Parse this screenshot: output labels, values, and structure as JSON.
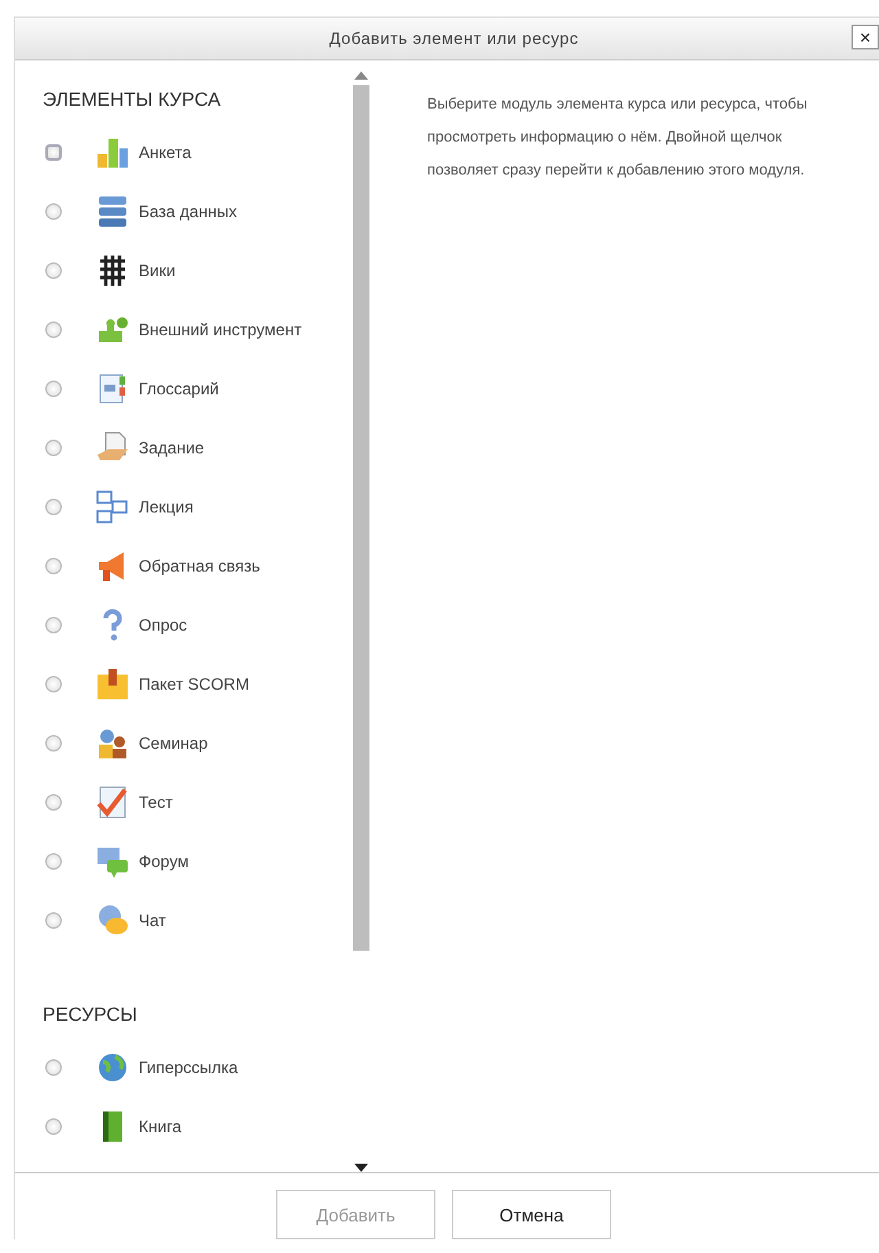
{
  "dialog": {
    "title": "Добавить элемент или ресурс",
    "close_label": "×"
  },
  "sections": [
    {
      "heading": "ЭЛЕМЕНТЫ КУРСА",
      "items": [
        {
          "label": "Анкета",
          "selected": false,
          "focused": true
        },
        {
          "label": "База данных",
          "selected": false,
          "focused": false
        },
        {
          "label": "Вики",
          "selected": false,
          "focused": false
        },
        {
          "label": "Внешний инструмент",
          "selected": false,
          "focused": false
        },
        {
          "label": "Глоссарий",
          "selected": false,
          "focused": false
        },
        {
          "label": "Задание",
          "selected": false,
          "focused": false
        },
        {
          "label": "Лекция",
          "selected": false,
          "focused": false
        },
        {
          "label": "Обратная связь",
          "selected": false,
          "focused": false
        },
        {
          "label": "Опрос",
          "selected": false,
          "focused": false
        },
        {
          "label": "Пакет SCORM",
          "selected": false,
          "focused": false
        },
        {
          "label": "Семинар",
          "selected": false,
          "focused": false
        },
        {
          "label": "Тест",
          "selected": false,
          "focused": false
        },
        {
          "label": "Форум",
          "selected": false,
          "focused": false
        },
        {
          "label": "Чат",
          "selected": false,
          "focused": false
        }
      ]
    },
    {
      "heading": "РЕСУРСЫ",
      "items": [
        {
          "label": "Гиперссылка",
          "selected": false,
          "focused": false
        },
        {
          "label": "Книга",
          "selected": false,
          "focused": false
        }
      ]
    }
  ],
  "description": "Выберите модуль элемента курса или ресурса, чтобы просмотреть информацию о нём. Двойной щелчок позволяет сразу перейти к добавлению этого модуля.",
  "buttons": [
    {
      "label": "Добавить",
      "disabled": true
    },
    {
      "label": "Отмена",
      "disabled": false
    }
  ]
}
